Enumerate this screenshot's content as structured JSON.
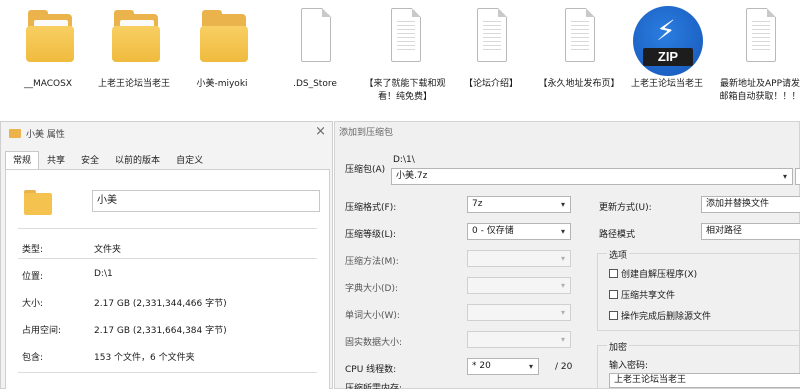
{
  "desktop": {
    "items": [
      {
        "label": "__MACOSX",
        "icon": "folder-icon"
      },
      {
        "label": "上老王论坛当老王",
        "icon": "folder-icon"
      },
      {
        "label": "小美-miyoki",
        "icon": "folder-icon"
      },
      {
        "label": ".DS_Store",
        "icon": "blank-file-icon"
      },
      {
        "label": "【来了就能下载和观看！纯免费】",
        "icon": "text-file-icon"
      },
      {
        "label": "【论坛介绍】",
        "icon": "text-file-icon"
      },
      {
        "label": "【永久地址发布页】",
        "icon": "text-file-icon"
      },
      {
        "label": "上老王论坛当老王",
        "icon": "zip-archive-icon"
      },
      {
        "label": "最新地址及APP请发邮箱自动获取！！！",
        "icon": "text-file-icon"
      }
    ],
    "zip_badge": "ZIP"
  },
  "properties": {
    "title": "小美 属性",
    "tabs": [
      "常规",
      "共享",
      "安全",
      "以前的版本",
      "自定义"
    ],
    "active_tab": "常规",
    "folder_name": "小美",
    "rows": [
      {
        "label": "类型:",
        "value": "文件夹"
      },
      {
        "label": "位置:",
        "value": "D:\\1"
      },
      {
        "label": "大小:",
        "value": "2.17 GB (2,331,344,466 字节)"
      },
      {
        "label": "占用空间:",
        "value": "2.17 GB (2,331,664,384 字节)"
      },
      {
        "label": "包含:",
        "value": "153 个文件，6 个文件夹"
      }
    ]
  },
  "archive": {
    "title": "添加到压缩包",
    "archive_label": "压缩包(A)",
    "archive_path": "D:\\1\\",
    "archive_name": "小美.7z",
    "left_fields": [
      {
        "label": "压缩格式(F):",
        "value": "7z",
        "enabled": true
      },
      {
        "label": "压缩等级(L):",
        "value": "0 - 仅存储",
        "enabled": true
      },
      {
        "label": "压缩方法(M):",
        "value": "",
        "enabled": false
      },
      {
        "label": "字典大小(D):",
        "value": "",
        "enabled": false
      },
      {
        "label": "单词大小(W):",
        "value": "",
        "enabled": false
      },
      {
        "label": "固实数据大小:",
        "value": "",
        "enabled": false
      }
    ],
    "cpu_label": "CPU 线程数:",
    "cpu_value": "* 20",
    "cpu_total": "/ 20",
    "memory_label": "压缩所需内存:",
    "update_mode_label": "更新方式(U):",
    "update_mode_value": "添加并替换文件",
    "path_mode_label": "路径模式",
    "path_mode_value": "相对路径",
    "options_title": "选项",
    "options": [
      {
        "label": "创建自解压程序(X)",
        "checked": false
      },
      {
        "label": "压缩共享文件",
        "checked": false
      },
      {
        "label": "操作完成后删除源文件",
        "checked": false
      }
    ],
    "encryption_title": "加密",
    "password_label": "输入密码:",
    "password_value": "上老王论坛当老王"
  }
}
